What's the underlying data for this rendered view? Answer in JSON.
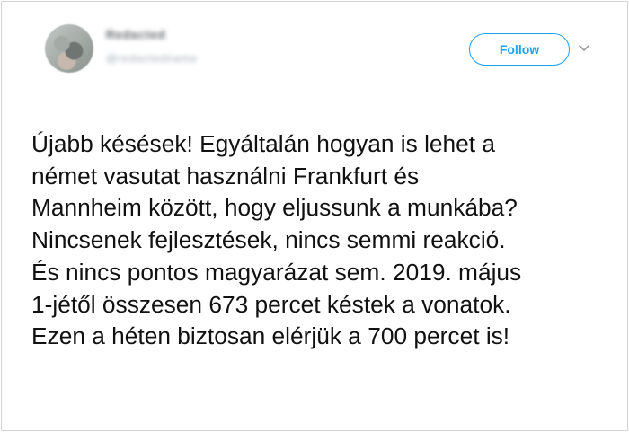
{
  "tweet": {
    "author": {
      "display_name": "Redacted",
      "handle": "@redactedname"
    },
    "follow_label": "Follow",
    "menu_icon": "chevron-down-icon",
    "text_lines": [
      "Újabb késések! Egyáltalán hogyan is lehet a",
      "német vasutat használni Frankfurt és",
      "Mannheim között, hogy eljussunk a munkába?",
      "Nincsenek fejlesztések, nincs semmi reakció.",
      "És nincs pontos magyarázat sem. 2019. május",
      "1-jétől összesen 673 percet késtek a vonatok.",
      "Ezen a héten biztosan elérjük a 700 percet is!"
    ]
  },
  "colors": {
    "accent": "#1da1f2",
    "text": "#111111",
    "border": "#d4d4d4",
    "chevron": "#9b9b9b"
  }
}
